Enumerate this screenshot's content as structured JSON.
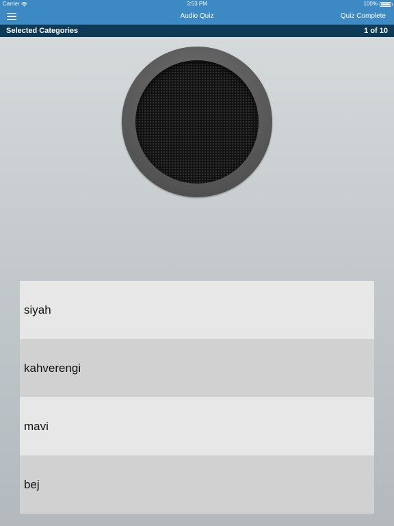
{
  "status_bar": {
    "carrier": "Carrier",
    "time": "3:53 PM",
    "battery": "100%",
    "battery_level": 1.0,
    "wifi_icon": "wifi-icon",
    "battery_icon": "battery-icon"
  },
  "nav": {
    "menu_icon": "hamburger-menu-icon",
    "title": "Audio Quiz",
    "right_action": "Quiz Complete"
  },
  "sub_bar": {
    "category": "Selected Categories",
    "progress": "1 of 10"
  },
  "speaker_icon": "speaker-icon",
  "answers": [
    {
      "label": "siyah"
    },
    {
      "label": "kahverengi"
    },
    {
      "label": "mavi"
    },
    {
      "label": "bej"
    }
  ],
  "colors": {
    "nav_bar": "#3d89c4",
    "sub_bar": "#0d3a57",
    "answer_light": "#e7e7e7",
    "answer_dark": "#d1d1d1"
  }
}
